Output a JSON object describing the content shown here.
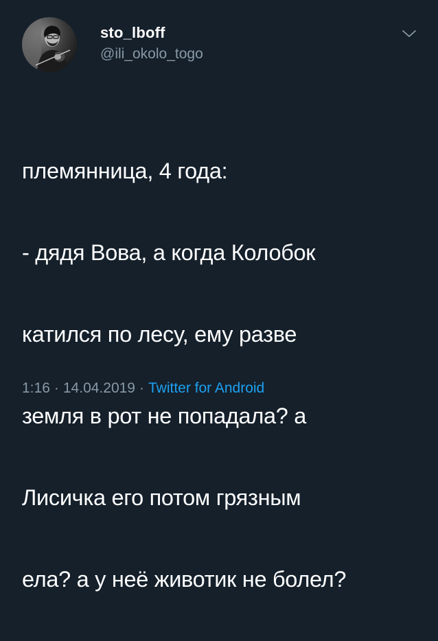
{
  "tweet": {
    "display_name": "sto_lboff",
    "handle": "@ili_okolo_togo",
    "text_lines": [
      "племянница, 4 года:",
      "- дядя Вова, а когда Колобок",
      "катился по лесу, ему разве",
      "земля в рот не попадала? а",
      "Лисичка его потом грязным",
      "ела? а у неё животик не болел?"
    ],
    "time": "1:16",
    "date": "14.04.2019",
    "separator": "·",
    "source": "Twitter for Android"
  },
  "icons": {
    "avatar": "avatar-photo-man-with-violin",
    "menu": "chevron-down-icon"
  },
  "colors": {
    "background": "#15202b",
    "text": "#ffffff",
    "secondary": "#8899a6",
    "link": "#1da1f2"
  }
}
